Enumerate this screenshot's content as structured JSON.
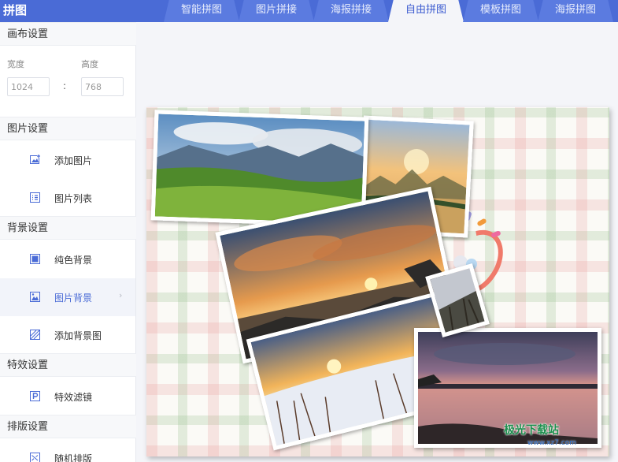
{
  "app": {
    "title": "拼图"
  },
  "tabs": [
    {
      "label": "智能拼图",
      "active": false
    },
    {
      "label": "图片拼接",
      "active": false
    },
    {
      "label": "海报拼接",
      "active": false
    },
    {
      "label": "自由拼图",
      "active": true
    },
    {
      "label": "模板拼图",
      "active": false
    },
    {
      "label": "海报拼图",
      "active": false
    }
  ],
  "sidebar": {
    "canvas_settings": {
      "heading": "画布设置",
      "width_label": "宽度",
      "height_label": "高度",
      "width_value": "1024",
      "height_value": "768",
      "separator": ":"
    },
    "image_settings": {
      "heading": "图片设置",
      "items": [
        {
          "label": "添加图片",
          "icon": "add-image-icon"
        },
        {
          "label": "图片列表",
          "icon": "list-icon"
        }
      ]
    },
    "background_settings": {
      "heading": "背景设置",
      "items": [
        {
          "label": "纯色背景",
          "icon": "solid-color-icon"
        },
        {
          "label": "图片背景",
          "icon": "image-background-icon",
          "active": true
        },
        {
          "label": "添加背景图",
          "icon": "add-background-icon"
        }
      ]
    },
    "effect_settings": {
      "heading": "特效设置",
      "items": [
        {
          "label": "特效滤镜",
          "icon": "filter-icon"
        }
      ]
    },
    "layout_settings": {
      "heading": "排版设置",
      "items": [
        {
          "label": "随机排版",
          "icon": "shuffle-icon"
        }
      ]
    }
  },
  "canvas": {
    "background": "plaid-pattern",
    "photos": [
      {
        "scene": "mountain-meadow"
      },
      {
        "scene": "foggy-sunrise-lake"
      },
      {
        "scene": "sunset-clouds-sea"
      },
      {
        "scene": "snowy-sunset"
      },
      {
        "scene": "purple-dusk-lake"
      }
    ]
  },
  "watermark": {
    "text": "极光下载站",
    "url": "www.xz7.com"
  },
  "colors": {
    "accent": "#4a6bd6",
    "topbar": "#4a6bd6",
    "deco": "#f07a6a"
  }
}
